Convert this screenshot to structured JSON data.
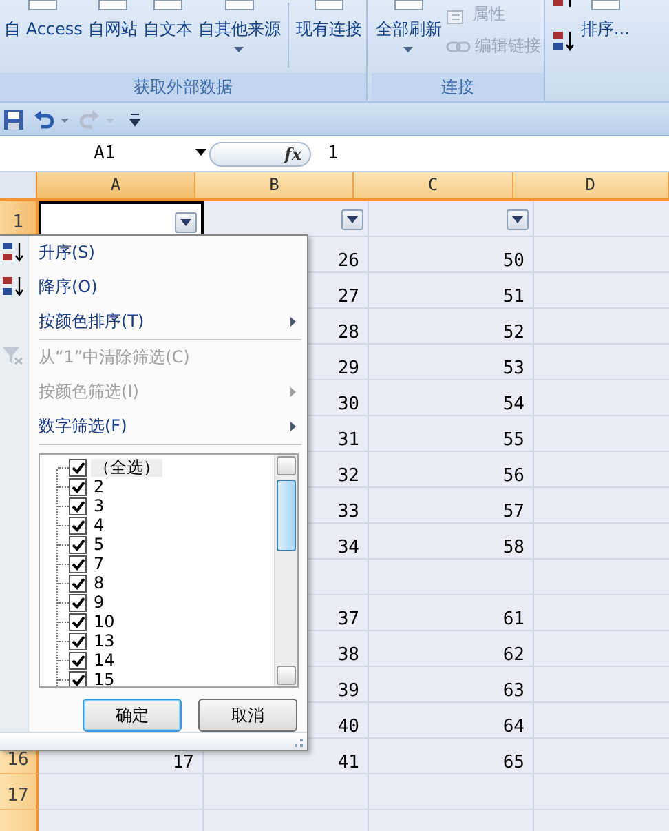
{
  "ribbon": {
    "groups": [
      {
        "label": "获取外部数据",
        "buttons": [
          {
            "kind": "large",
            "label": "自 Access",
            "dropdown": false,
            "disabled": false
          },
          {
            "kind": "large",
            "label": "自网站",
            "dropdown": false,
            "disabled": false
          },
          {
            "kind": "large",
            "label": "自文本",
            "dropdown": false,
            "disabled": false
          },
          {
            "kind": "large",
            "label": "自其他来源",
            "dropdown": true,
            "disabled": false
          },
          {
            "kind": "separator"
          },
          {
            "kind": "large",
            "label": "现有连接",
            "dropdown": false,
            "disabled": false
          }
        ]
      },
      {
        "label": "连接",
        "buttons": [
          {
            "kind": "large",
            "label": "全部刷新",
            "dropdown": true,
            "disabled": false
          },
          {
            "kind": "small",
            "label": "属性",
            "dropdown": false,
            "disabled": true
          },
          {
            "kind": "small",
            "label": "编辑链接",
            "dropdown": false,
            "disabled": true
          }
        ]
      },
      {
        "buttons": [
          {
            "kind": "sort_icons"
          },
          {
            "kind": "large",
            "label": "排序...",
            "dropdown": false,
            "disabled": false
          }
        ]
      }
    ]
  },
  "quick_access": [
    {
      "kind": "save",
      "disabled": false
    },
    {
      "kind": "undo",
      "disabled": false
    },
    {
      "kind": "redo",
      "disabled": true
    },
    {
      "kind": "customize",
      "disabled": false
    }
  ],
  "formula_bar": {
    "name_box": "A1",
    "function_label": "fx",
    "value": "1"
  },
  "sheet": {
    "columns": [
      {
        "label": "A",
        "filter": true,
        "active": true
      },
      {
        "label": "B",
        "filter": true,
        "active": false
      },
      {
        "label": "C",
        "filter": true,
        "active": false
      },
      {
        "label": "D",
        "filter": false,
        "active": false
      }
    ],
    "rows": [
      {
        "header": "1",
        "active": true
      },
      {
        "b": "26",
        "c": "50"
      },
      {
        "b": "27",
        "c": "51"
      },
      {
        "b": "28",
        "c": "52"
      },
      {
        "b": "29",
        "c": "53"
      },
      {
        "b": "30",
        "c": "54"
      },
      {
        "b": "31",
        "c": "55"
      },
      {
        "b": "32",
        "c": "56"
      },
      {
        "b": "33",
        "c": "57"
      },
      {
        "b": "34",
        "c": "58"
      },
      {},
      {
        "b": "37",
        "c": "61"
      },
      {
        "b": "38",
        "c": "62"
      },
      {
        "b": "39",
        "c": "63"
      },
      {
        "b": "40",
        "c": "64"
      },
      {
        "header": "16",
        "a": "17",
        "b": "41",
        "c": "65"
      },
      {
        "header": "17"
      },
      {}
    ]
  },
  "filter_menu": {
    "items": [
      {
        "kind": "sort_ascending",
        "label": "升序(S)",
        "disabled": false,
        "submenu": false
      },
      {
        "kind": "sort_descending",
        "label": "降序(O)",
        "disabled": false,
        "submenu": false
      },
      {
        "kind": "plain",
        "label": "按颜色排序(T)",
        "disabled": false,
        "submenu": true
      },
      {
        "kind": "separator"
      },
      {
        "kind": "clear_filter",
        "label": "从“1”中清除筛选(C)",
        "disabled": true,
        "submenu": false
      },
      {
        "kind": "plain",
        "label": "按颜色筛选(I)",
        "disabled": true,
        "submenu": true
      },
      {
        "kind": "plain",
        "label": "数字筛选(F)",
        "disabled": false,
        "submenu": true
      },
      {
        "kind": "separator"
      }
    ],
    "values": [
      {
        "label": "（全选）",
        "checked": true,
        "selected": true
      },
      {
        "label": "2",
        "checked": true,
        "selected": false
      },
      {
        "label": "3",
        "checked": true,
        "selected": false
      },
      {
        "label": "4",
        "checked": true,
        "selected": false
      },
      {
        "label": "5",
        "checked": true,
        "selected": false
      },
      {
        "label": "7",
        "checked": true,
        "selected": false
      },
      {
        "label": "8",
        "checked": true,
        "selected": false
      },
      {
        "label": "9",
        "checked": true,
        "selected": false
      },
      {
        "label": "10",
        "checked": true,
        "selected": false
      },
      {
        "label": "13",
        "checked": true,
        "selected": false
      },
      {
        "label": "14",
        "checked": true,
        "selected": false
      },
      {
        "label": "15",
        "checked": true,
        "selected": false
      }
    ],
    "buttons": [
      {
        "label": "确定",
        "selected": true
      },
      {
        "label": "取消",
        "selected": false
      }
    ]
  }
}
